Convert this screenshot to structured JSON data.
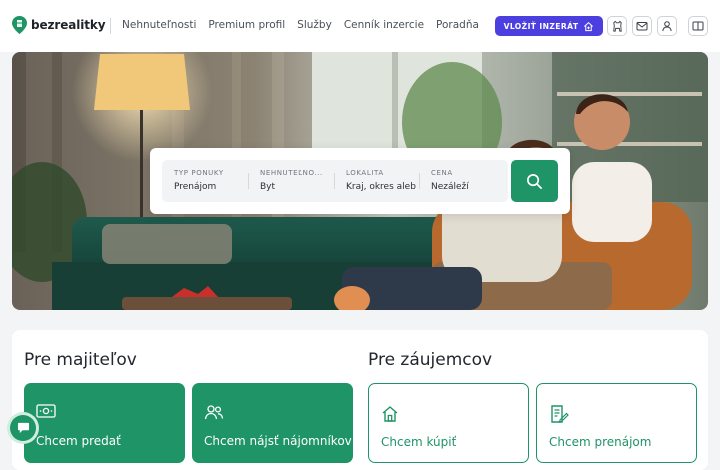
{
  "brand": {
    "name": "bezrealitky"
  },
  "nav": {
    "items": [
      "Nehnuteľnosti",
      "Premium profil",
      "Služby",
      "Cenník inzercie",
      "Poradňa"
    ]
  },
  "header": {
    "cta_label": "VLOŽIŤ INZERÁT",
    "icons": [
      "dog-icon",
      "mail-icon",
      "user-icon",
      "menu-icon"
    ]
  },
  "search": {
    "fields": [
      {
        "label": "TYP PONUKY",
        "value": "Prenájom"
      },
      {
        "label": "NEHNUTEĽNO...",
        "value": "Byt"
      },
      {
        "label": "LOKALITA",
        "value": "Kraj, okres aleb"
      },
      {
        "label": "CENA",
        "value": "Nezáleží"
      }
    ],
    "button_icon": "search-icon"
  },
  "owners": {
    "title": "Pre majiteľov",
    "cards": [
      {
        "label": "Chcem predať",
        "icon": "money-icon"
      },
      {
        "label": "Chcem nájsť nájomníkov",
        "icon": "people-icon"
      }
    ]
  },
  "seekers": {
    "title": "Pre záujemcov",
    "cards": [
      {
        "label": "Chcem kúpiť",
        "icon": "house-icon"
      },
      {
        "label": "Chcem prenájom",
        "icon": "contract-icon"
      }
    ]
  },
  "colors": {
    "accent": "#1e9467",
    "cta": "#4c3fe0"
  }
}
